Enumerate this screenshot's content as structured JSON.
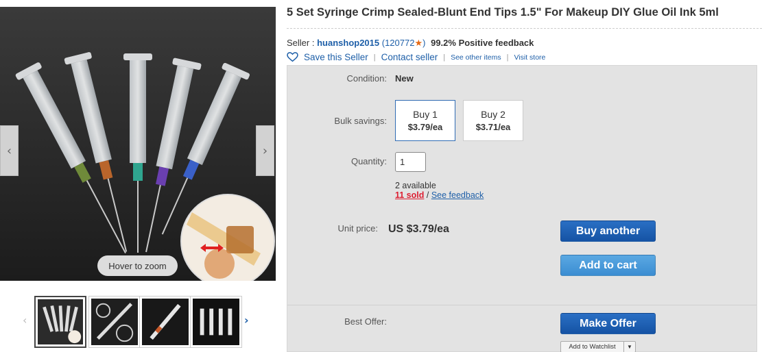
{
  "gallery": {
    "zoom_hint": "Hover to zoom",
    "prev_arrow": "‹",
    "next_arrow": "›",
    "thumbs_prev": "‹",
    "thumbs_next": "›",
    "thumbnails": [
      "thumbnail-1",
      "thumbnail-2",
      "thumbnail-3",
      "thumbnail-4"
    ],
    "selected_thumbnail": 1
  },
  "listing": {
    "title": "5 Set Syringe Crimp Sealed-Blunt End Tips 1.5\" For Makeup DIY Glue Oil Ink 5ml"
  },
  "seller": {
    "label": "Seller :",
    "name": "huanshop2015",
    "score_open": "(120772",
    "star": "★",
    "score_close": ")",
    "feedback": "99.2% Positive feedback",
    "save_label": "Save this Seller",
    "contact_label": "Contact seller",
    "other_items_label": "See other items",
    "visit_store_label": "Visit store",
    "separator": "|"
  },
  "purchase": {
    "condition_label": "Condition:",
    "condition_value": "New",
    "bulk_label": "Bulk savings:",
    "bulk_options": [
      {
        "qty": "Buy 1",
        "price": "$3.79/ea",
        "selected": true
      },
      {
        "qty": "Buy 2",
        "price": "$3.71/ea",
        "selected": false
      }
    ],
    "quantity_label": "Quantity:",
    "quantity_value": "1",
    "available": "2 available",
    "sold": "11 sold",
    "slash": "/",
    "see_feedback": "See feedback",
    "unit_price_label": "Unit price:",
    "unit_price_value": "US $3.79/ea",
    "buy_button": "Buy another",
    "cart_button": "Add to cart",
    "best_offer_label": "Best Offer:",
    "offer_button": "Make Offer",
    "watchlist_button": "Add to Watchlist",
    "watchlist_dropdown": "▼"
  },
  "colors": {
    "link": "#1e5fa8",
    "primary_button": "#1553a4",
    "secondary_button": "#3b8dd2",
    "sold": "#dd1e31",
    "panel": "#e3e3e3"
  },
  "icons": [
    "heart-icon",
    "star-icon",
    "chevron-left-icon",
    "chevron-right-icon",
    "dropdown-arrow-icon"
  ]
}
